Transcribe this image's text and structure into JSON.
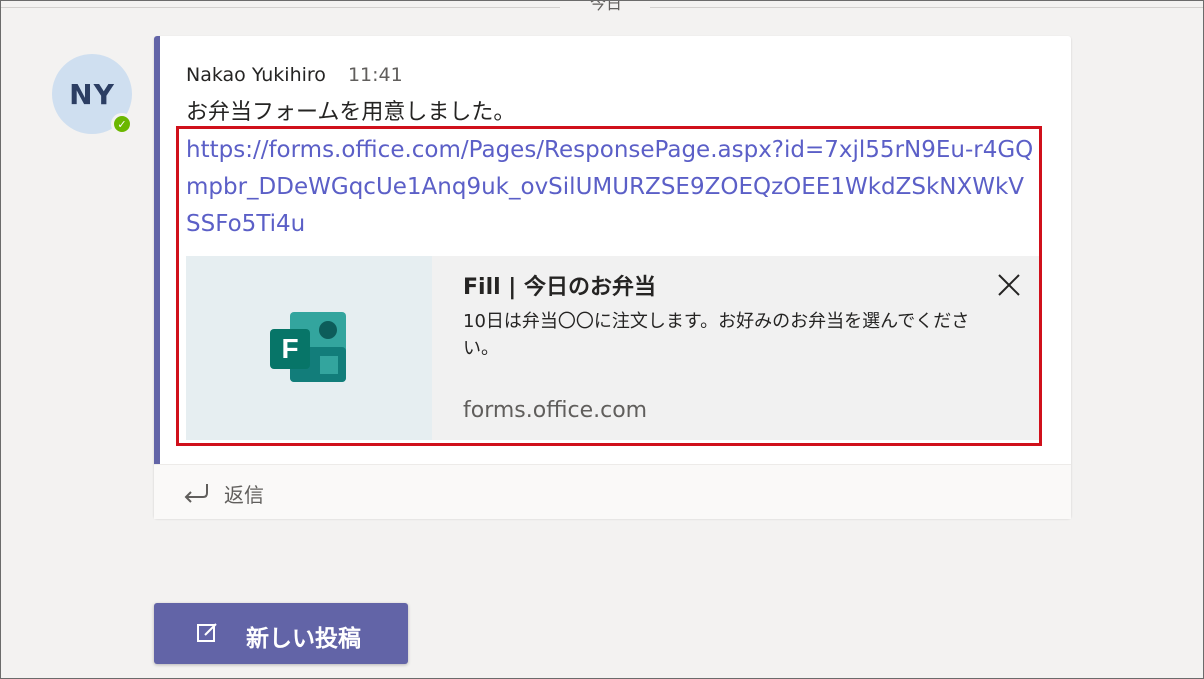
{
  "date_divider": {
    "label": "今日"
  },
  "post": {
    "avatar_initials": "NY",
    "author": "Nakao Yukihiro",
    "time": "11:41",
    "message": "お弁当フォームを用意しました。",
    "link": "https://forms.office.com/Pages/ResponsePage.aspx?id=7xjl55rN9Eu-r4GQmpbr_DDeWGqcUe1Anq9uk_ovSilUMURZSE9ZOEQzOEE1WkdZSkNXWkVSSFo5Ti4u",
    "preview": {
      "title": "Fill | 今日のお弁当",
      "description": "10日は弁当〇〇に注文します。お好みのお弁当を選んでください。",
      "domain": "forms.office.com",
      "icon": "microsoft-forms-logo"
    },
    "reply_label": "返信"
  },
  "new_post_button": {
    "label": "新しい投稿"
  },
  "colors": {
    "accent": "#6264a7",
    "link": "#5b5fc7",
    "highlight_border": "#d0101b",
    "presence": "#6bb700",
    "background": "#f3f2f1"
  }
}
